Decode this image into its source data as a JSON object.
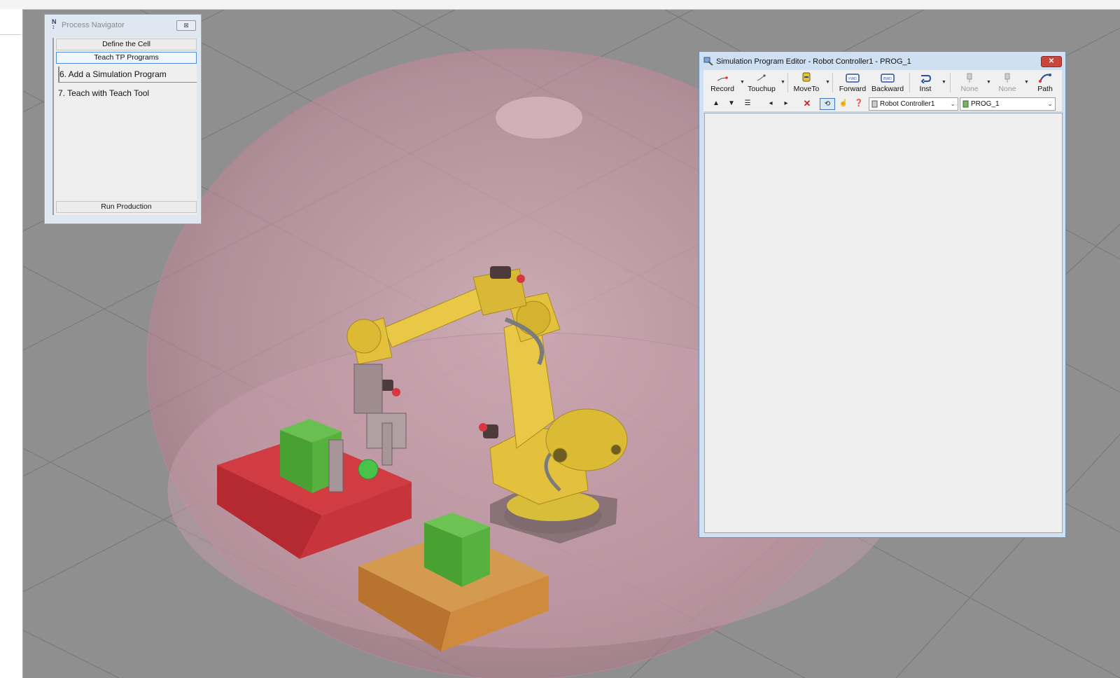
{
  "process_navigator": {
    "title": "Process Navigator",
    "close_symbol": "⊠",
    "define_cell": "Define the Cell",
    "teach_tp": "Teach TP Programs",
    "steps": [
      {
        "label": "6.  Add a Simulation Program"
      },
      {
        "label": "7.  Teach with Teach Tool"
      }
    ],
    "run_production": "Run Production"
  },
  "editor": {
    "title": "Simulation Program Editor - Robot Controller1 - PROG_1",
    "close_symbol": "✕",
    "tools": {
      "record": "Record",
      "touchup": "Touchup",
      "moveto": "MoveTo",
      "forward": "Forward",
      "backward": "Backward",
      "inst": "Inst",
      "none1": "None",
      "none2": "None",
      "path": "Path"
    },
    "controller_select": "Robot Controller1",
    "program_select": "PROG_1"
  },
  "colors": {
    "envelope": "#d8a6b6",
    "robot_yellow": "#e3c13c",
    "table_red": "#c9333b",
    "table_orange": "#c98235",
    "part_green": "#55b13d",
    "floor": "#8f8f8f"
  },
  "icons": [
    "process-navigator-icon",
    "close-icon",
    "record-icon",
    "touchup-icon",
    "moveto-icon",
    "forward-icon",
    "backward-icon",
    "inst-icon",
    "none-icon",
    "path-icon",
    "arrow-up-icon",
    "arrow-down-icon",
    "list-icon",
    "chevron-left-icon",
    "chevron-right-icon",
    "delete-icon",
    "teach-icon",
    "hand-icon",
    "help-icon",
    "controller-icon",
    "program-icon"
  ]
}
